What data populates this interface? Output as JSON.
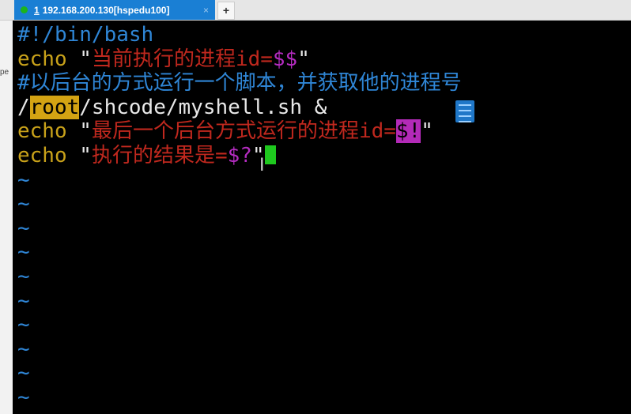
{
  "tab": {
    "number": "1",
    "title": "192.168.200.130[hspedu100]",
    "close": "×",
    "new_tab": "+"
  },
  "left_strip": {
    "fragment": "pe"
  },
  "editor": {
    "lines": [
      {
        "comment": "#!/bin/bash"
      },
      {
        "keyword": "echo",
        "space": " ",
        "q1": "\"",
        "string": "当前执行的进程id=",
        "var": "$$",
        "q2": "\""
      },
      {
        "comment": "#以后台的方式运行一个脚本，并获取他的进程号"
      },
      {
        "pre": "/",
        "highlight": "root",
        "post": "/shcode/myshell.sh &"
      },
      {
        "keyword": "echo",
        "space": " ",
        "q1": "\"",
        "string": "最后一个后台方式运行的进程id=",
        "var": "$!",
        "q2": "\""
      },
      {
        "keyword": "echo",
        "space": " ",
        "q1": "\"",
        "string": "执行的结果是=",
        "var": "$?",
        "q2": "\""
      }
    ],
    "tilde": "~"
  },
  "colors": {
    "comment": "#2f86d6",
    "keyword": "#c9a21a",
    "string": "#c0281e",
    "variable": "#b42cc0",
    "cursor": "#1ec81e",
    "tab": "#1a7fd4"
  }
}
